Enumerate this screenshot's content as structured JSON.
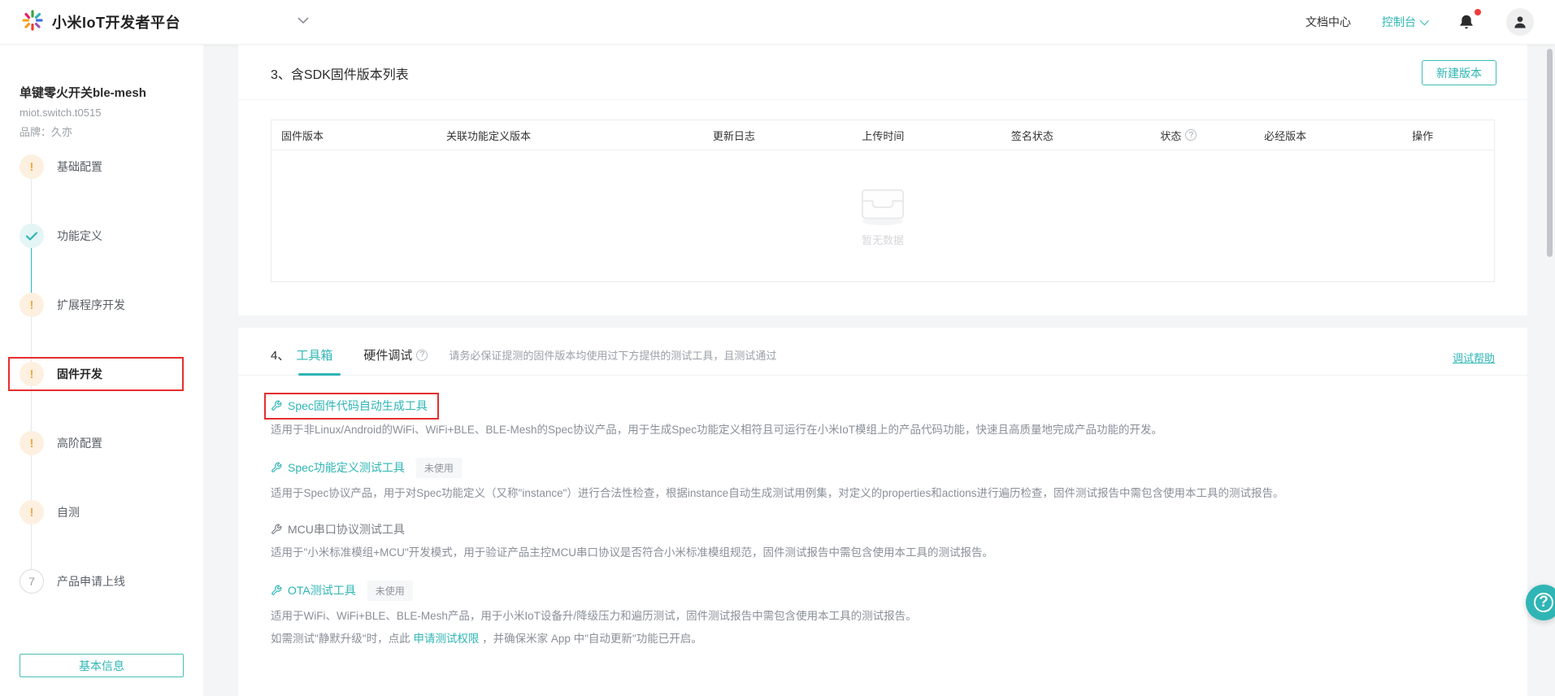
{
  "colors": {
    "accent_teal": "#2fb5b5",
    "warning_orange": "#f5a843",
    "warning_bg": "#fdf0e0",
    "annotation_red": "#e62e2e",
    "muted_gray": "#9aa0a6"
  },
  "icons": {
    "logo": "xiaomi-iot-starburst",
    "product_switcher": "chevron-down",
    "console_caret": "chevron-down",
    "notifications": "bell-with-red-dot",
    "account": "person-avatar",
    "status_help": "question-circle",
    "hardware_debug_help": "question-circle",
    "tool": "wrench",
    "empty": "inbox-tray",
    "floating_help": "question-circle"
  },
  "topbar": {
    "title": "小米IoT开发者平台",
    "doc_center": "文档中心",
    "console": "控制台"
  },
  "sidebar": {
    "product_name": "单键零火开关ble-mesh",
    "product_model": "miot.switch.t0515",
    "brand": "品牌：久亦",
    "steps": [
      {
        "label": "基础配置",
        "status": "warning"
      },
      {
        "label": "功能定义",
        "status": "done"
      },
      {
        "label": "扩展程序开发",
        "status": "warning"
      },
      {
        "label": "固件开发",
        "status": "warning",
        "highlighted": true
      },
      {
        "label": "高阶配置",
        "status": "warning"
      },
      {
        "label": "自测",
        "status": "warning"
      },
      {
        "label": "产品申请上线",
        "status": "number",
        "number": "7"
      }
    ],
    "basic_info_button": "基本信息"
  },
  "firmware_section": {
    "title": "3、含SDK固件版本列表",
    "new_version_button": "新建版本",
    "table_headers": [
      "固件版本",
      "关联功能定义版本",
      "更新日志",
      "上传时间",
      "签名状态",
      "状态",
      "必经版本",
      "操作"
    ],
    "empty_text": "暂无数据"
  },
  "toolbox_section": {
    "number": "4、",
    "tabs": [
      {
        "label": "工具箱",
        "active": true
      },
      {
        "label": "硬件调试",
        "active": false
      }
    ],
    "note": "请务必保证提测的固件版本均使用过下方提供的测试工具，且测试通过",
    "help_link": "调试帮助",
    "tools": [
      {
        "name": "Spec固件代码自动生成工具",
        "highlighted": true,
        "desc": "适用于非Linux/Android的WiFi、WiFi+BLE、BLE-Mesh的Spec协议产品，用于生成Spec功能定义相符且可运行在小米IoT模组上的产品代码功能，快速且高质量地完成产品功能的开发。"
      },
      {
        "name": "Spec功能定义测试工具",
        "badge": "未使用",
        "desc": "适用于Spec协议产品，用于对Spec功能定义（又称\"instance\"）进行合法性检查，根据instance自动生成测试用例集，对定义的properties和actions进行遍历检查，固件测试报告中需包含使用本工具的测试报告。"
      },
      {
        "name": "MCU串口协议测试工具",
        "muted": true,
        "desc": "适用于\"小米标准模组+MCU\"开发模式，用于验证产品主控MCU串口协议是否符合小米标准模组规范，固件测试报告中需包含使用本工具的测试报告。"
      },
      {
        "name": "OTA测试工具",
        "badge": "未使用",
        "desc": "适用于WiFi、WiFi+BLE、BLE-Mesh产品，用于小米IoT设备升/降级压力和遍历测试，固件测试报告中需包含使用本工具的测试报告。",
        "extra_prefix": "如需测试\"静默升级\"时，点此 ",
        "extra_link": "申请测试权限",
        "extra_suffix": " ，并确保米家 App 中\"自动更新\"功能已开启。"
      }
    ]
  }
}
